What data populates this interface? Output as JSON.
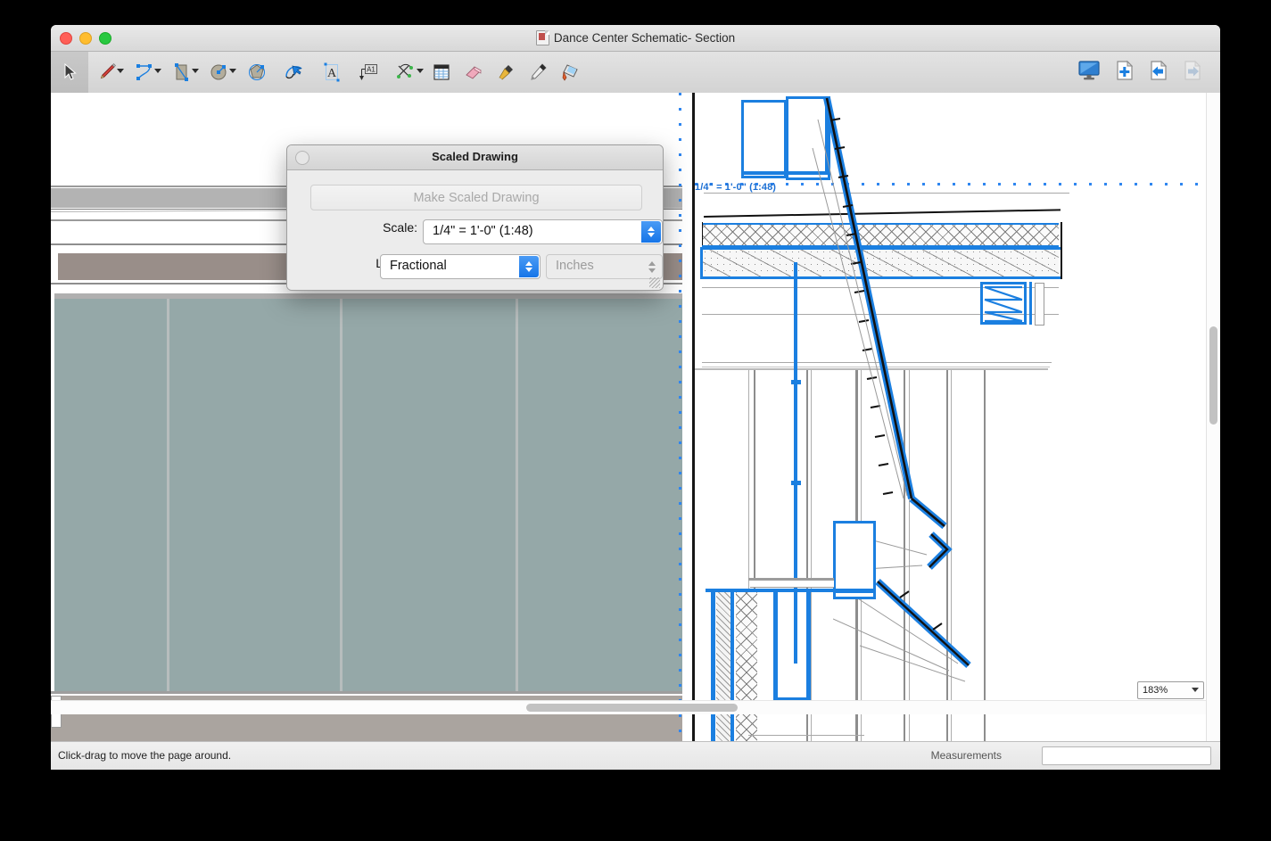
{
  "window": {
    "title": "Dance Center Schematic- Section",
    "traffic_lights": [
      "close",
      "minimize",
      "zoom"
    ]
  },
  "toolbar": {
    "left_tools": [
      {
        "name": "select-arrow-tool",
        "icon": "arrow-cursor-icon",
        "active": true,
        "menu": false
      },
      {
        "name": "pencil-tool",
        "icon": "pencil-icon",
        "active": false,
        "menu": true
      },
      {
        "name": "curve-tool",
        "icon": "bezier-curve-icon",
        "active": false,
        "menu": true
      },
      {
        "name": "rectangle-tool",
        "icon": "rectangle-icon",
        "active": false,
        "menu": true
      },
      {
        "name": "circle-tool",
        "icon": "circle-icon",
        "active": false,
        "menu": true
      },
      {
        "name": "polygon-tool",
        "icon": "polygon-icon",
        "active": false,
        "menu": false
      },
      {
        "name": "lasso-select-tool",
        "icon": "lasso-arrow-icon",
        "active": false,
        "menu": false
      },
      {
        "name": "text-tool",
        "icon": "text-a-icon",
        "active": false,
        "menu": false
      },
      {
        "name": "label-tool",
        "icon": "label-a1-icon",
        "active": false,
        "menu": false
      },
      {
        "name": "transform-tool",
        "icon": "transform-nodes-icon",
        "active": false,
        "menu": true
      },
      {
        "name": "table-tool",
        "icon": "table-grid-icon",
        "active": false,
        "menu": false
      },
      {
        "name": "eraser-tool",
        "icon": "eraser-icon",
        "active": false,
        "menu": false
      },
      {
        "name": "eyedropper-tool",
        "icon": "eyedropper-icon",
        "active": false,
        "menu": false
      },
      {
        "name": "pen-tool",
        "icon": "fountain-pen-icon",
        "active": false,
        "menu": false
      },
      {
        "name": "paint-style-tool",
        "icon": "paint-bucket-icon",
        "active": false,
        "menu": false
      }
    ],
    "right_tools": [
      {
        "name": "presentation-mode-button",
        "icon": "monitor-icon",
        "enabled": true
      },
      {
        "name": "add-page-button",
        "icon": "page-plus-icon",
        "enabled": true
      },
      {
        "name": "previous-page-button",
        "icon": "page-arrow-left-icon",
        "enabled": true
      },
      {
        "name": "next-page-button",
        "icon": "page-arrow-right-icon",
        "enabled": false
      }
    ]
  },
  "dialog": {
    "title": "Scaled Drawing",
    "close_button": "close",
    "make_button": {
      "label": "Make Scaled Drawing",
      "enabled": false
    },
    "scale": {
      "label": "Scale:",
      "value": "1/4\" = 1'-0\" (1:48)"
    },
    "length": {
      "label": "Length:",
      "value": "Fractional"
    },
    "units": {
      "value": "Inches",
      "enabled": false
    },
    "resize_grip": "resize-grip"
  },
  "canvas": {
    "scale_annotation": "1/4\" = 1'-0\" (1:48)",
    "accent_blue": "#1b7fe0",
    "guide_blue": "#2f86f0",
    "seating_fill": "#95a8a8",
    "band_fill": "#998e89",
    "lower_band_fill": "#aaa49f",
    "drawing_type": "architectural building section"
  },
  "scrollbars": {
    "vertical": "vertical-scrollbar",
    "horizontal": "horizontal-scrollbar"
  },
  "zoom": {
    "value": "183%"
  },
  "status": {
    "hint": "Click-drag to move the page around.",
    "measurements_label": "Measurements",
    "measurements_value": ""
  }
}
